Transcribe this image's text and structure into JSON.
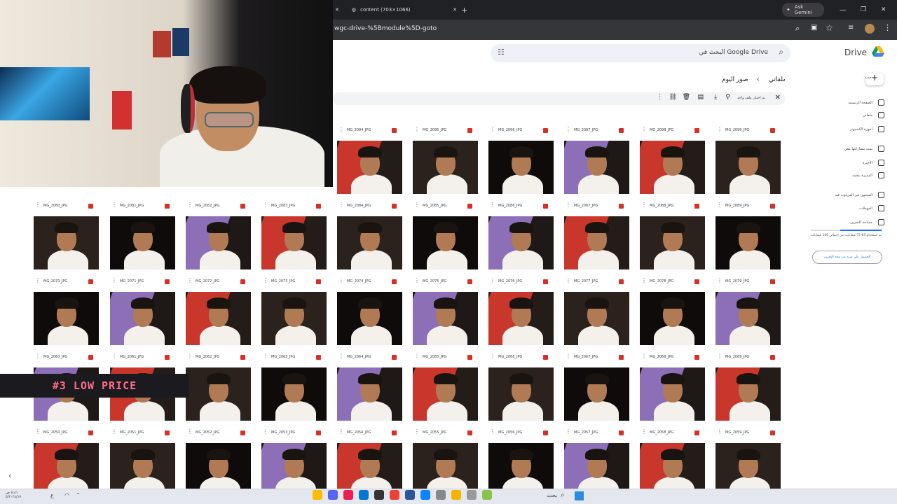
{
  "browser": {
    "tabs": [
      {
        "label": "content (703×1066)"
      }
    ],
    "ask_gemini": "Ask Gemini",
    "url": "wgc-drive-%5Bmodule%5D-goto"
  },
  "drive": {
    "brand": "Drive",
    "search_placeholder": "البحث في Google Drive",
    "breadcrumb_root": "ملفاتي",
    "breadcrumb_folder": "صور اليوم",
    "selection_text": "تم اختيار ملف واحد",
    "new_button": "جديد",
    "sidebar": [
      {
        "label": "الصفحة الرئيسية",
        "icon": "home-icon"
      },
      {
        "label": "ملفاتي",
        "icon": "drive-icon"
      },
      {
        "label": "أجهزة الكمبيوتر",
        "icon": "computer-icon"
      },
      {
        "label": "تمت مشاركتها معي",
        "icon": "people-icon"
      },
      {
        "label": "الأخيرة",
        "icon": "clock-icon"
      },
      {
        "label": "المميزة بنجمة",
        "icon": "star-icon"
      },
      {
        "label": "المحتوى غير المرغوب فيه",
        "icon": "spam-icon"
      },
      {
        "label": "المهملات",
        "icon": "trash-icon"
      },
      {
        "label": "مساحة التخزين",
        "icon": "cloud-icon"
      }
    ],
    "storage_text": "تم استخدام 57.65 غيغابايت من إجمالي 100 غيغابايت",
    "storage_button": "الحصول على مزيد من سعة التخزين",
    "rows": [
      [
        "MG_2099_JPG",
        "MG_2098_JPG",
        "MG_2097_JPG",
        "MG_2096_JPG",
        "MG_2095_JPG",
        "MG_2094_JPG"
      ],
      [
        "MG_2089_JPG",
        "MG_2088_JPG",
        "MG_2087_JPG",
        "MG_2086_JPG",
        "MG_2085_JPG",
        "MG_2084_JPG",
        "MG_2083_JPG",
        "MG_2082_JPG",
        "MG_2081_JPG",
        "MG_2080_JPG"
      ],
      [
        "MG_2079_JPG",
        "MG_2078_JPG",
        "MG_2077_JPG",
        "MG_2076_JPG",
        "MG_2075_JPG",
        "MG_2074_JPG",
        "MG_2073_JPG",
        "MG_2072_JPG",
        "MG_2071_JPG",
        "MG_2070_JPG"
      ],
      [
        "MG_2069_JPG",
        "MG_2068_JPG",
        "MG_2067_JPG",
        "MG_2066_JPG",
        "MG_2065_JPG",
        "MG_2064_JPG",
        "MG_2063_JPG",
        "MG_2062_JPG",
        "MG_2061_JPG",
        "MG_2060_JPG"
      ],
      [
        "MG_2059_JPG",
        "MG_2058_JPG",
        "MG_2057_JPG",
        "MG_2056_JPG",
        "MG_2055_JPG",
        "MG_2054_JPG",
        "MG_2053_JPG",
        "MG_2052_JPG",
        "MG_2051_JPG",
        "MG_2050_JPG"
      ]
    ]
  },
  "overlay_text": "#3 LOW PRICE",
  "taskbar": {
    "search": "بحث",
    "time": "٨:٤١ ص",
    "date": "٥/٢٠٢٤/١٧"
  }
}
